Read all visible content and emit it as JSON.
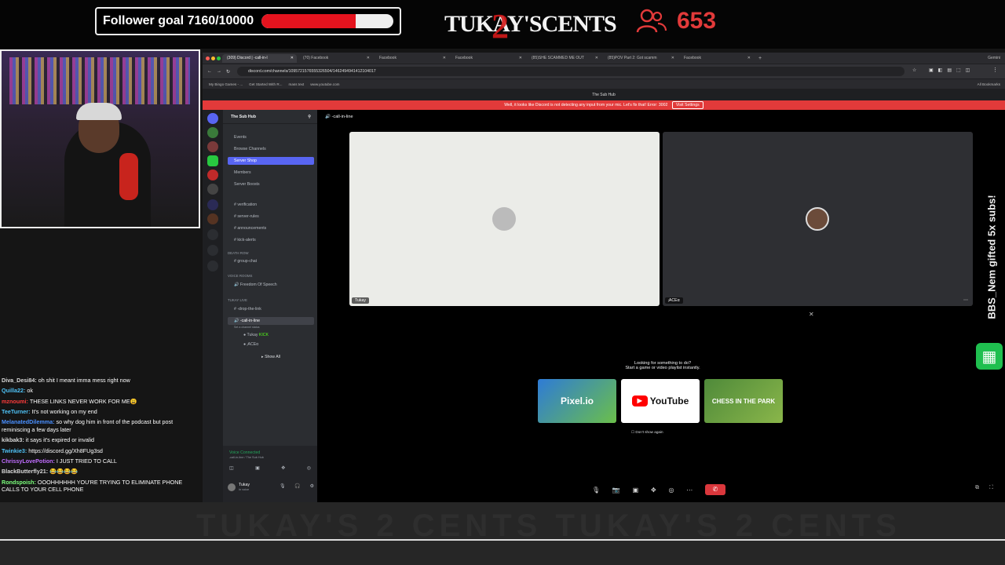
{
  "overlay": {
    "follower_goal_label": "Follower goal 7160/10000",
    "follower_goal_progress": 0.716,
    "brand": "TUKAY'S",
    "brand_number": "2",
    "brand_suffix": "CENTS",
    "viewer_count": "653",
    "gifted_text": "BBS_Nem gifted 5x subs!",
    "metal_watermark": "TUKAY'S 2 CENTS TUKAY'S 2 CENTS"
  },
  "chat": [
    {
      "user": "Diva_Desi84:",
      "text": "oh shit I meant imma mess right now",
      "color": "#d9d9d9"
    },
    {
      "user": "Quilla22:",
      "text": "ok",
      "color": "#4fc3f7"
    },
    {
      "user": "mznoumi:",
      "text": "THESE LINKS NEVER WORK FOR ME😩",
      "color": "#ff3b3b"
    },
    {
      "user": "TeeTurner:",
      "text": "It's not working on my end",
      "color": "#4fc3f7"
    },
    {
      "user": "MelanatedDilemma:",
      "text": "so why dog him in front of the podcast but post reminiscing a few days later",
      "color": "#4a90ff"
    },
    {
      "user": "kikbak3:",
      "text": "it says it's expired or invalid",
      "color": "#d9d9d9"
    },
    {
      "user": "Twinkie3:",
      "text": "https://discord.gg/Xh8FUg3sd",
      "color": "#4fc3f7"
    },
    {
      "user": "ChrissyLovePotion:",
      "text": "I JUST TRIED TO CALL",
      "color": "#c06cff"
    },
    {
      "user": "BlackButterfly21:",
      "text": "😂😂😂😂",
      "color": "#d9d9d9"
    },
    {
      "user": "Rondspoish:",
      "text": "OOOHHHHHH YOU'RE TRYING TO ELIMINATE PHONE CALLS TO YOUR CELL PHONE",
      "color": "#7cff7c"
    }
  ],
  "browser": {
    "tabs": [
      {
        "label": "(309) Discord | -call-in-l",
        "active": true
      },
      {
        "label": "(70) Facebook",
        "active": false
      },
      {
        "label": "Facebook",
        "active": false
      },
      {
        "label": "Facebook",
        "active": false
      },
      {
        "label": "(85)SHE SCAMMED ME OUT",
        "active": false
      },
      {
        "label": "(85)POV Part 2: Got scamm",
        "active": false
      },
      {
        "label": "Facebook",
        "active": false
      }
    ],
    "gemini_label": "Gemini",
    "url": "discord.com/channels/1095721576555326504/1462494941412104017",
    "bookmarks": [
      "My Bingo Games - ...",
      "Get Started With R...",
      "mass text",
      "www.youtube.com"
    ],
    "all_bookmarks": "All Bookmarks"
  },
  "discord": {
    "window_title": "The Sub Hub",
    "notice": "Well, it looks like Discord is not detecting any input from your mic. Let's fix that! Error: 3002",
    "notice_button": "Visit Settings",
    "server_name": "The Sub Hub",
    "nav": [
      "Events",
      "Browse Channels",
      "Server Shop",
      "Members",
      "Server Boosts"
    ],
    "channels_top": [
      "verification",
      "server-rules",
      "announcements",
      "kick-alerts"
    ],
    "category_death_row": "DEATH ROW",
    "channel_group_chat": "group-chat",
    "category_voice": "Voice Rooms",
    "channel_freedom": "Freedom Of Speech",
    "category_tukay": "TuKaY Live",
    "channel_drop": "-drop-the-link",
    "channel_call": "-call-in-line",
    "channel_status": "Set a channel status",
    "voice_users": [
      "Tukay",
      "ⱼACEα"
    ],
    "kick_tag": "KICK",
    "show_all": "Show All",
    "voice_connected": "Voice Connected",
    "voice_sub": "-call-in-line / The Sub Hub",
    "panel_user": "Tukay",
    "panel_status": "In voice",
    "stage_channel": "-call-in-line",
    "tile1_name": "Tukay",
    "tile2_name": "ⱼACEα",
    "activities_line1": "Looking for something to do?",
    "activities_line2": "Start a game or video playlist instantly.",
    "activity_cards": [
      "Pixel.io",
      "YouTube",
      "CHESS IN THE PARK"
    ],
    "dont_show": "Don't show again"
  }
}
